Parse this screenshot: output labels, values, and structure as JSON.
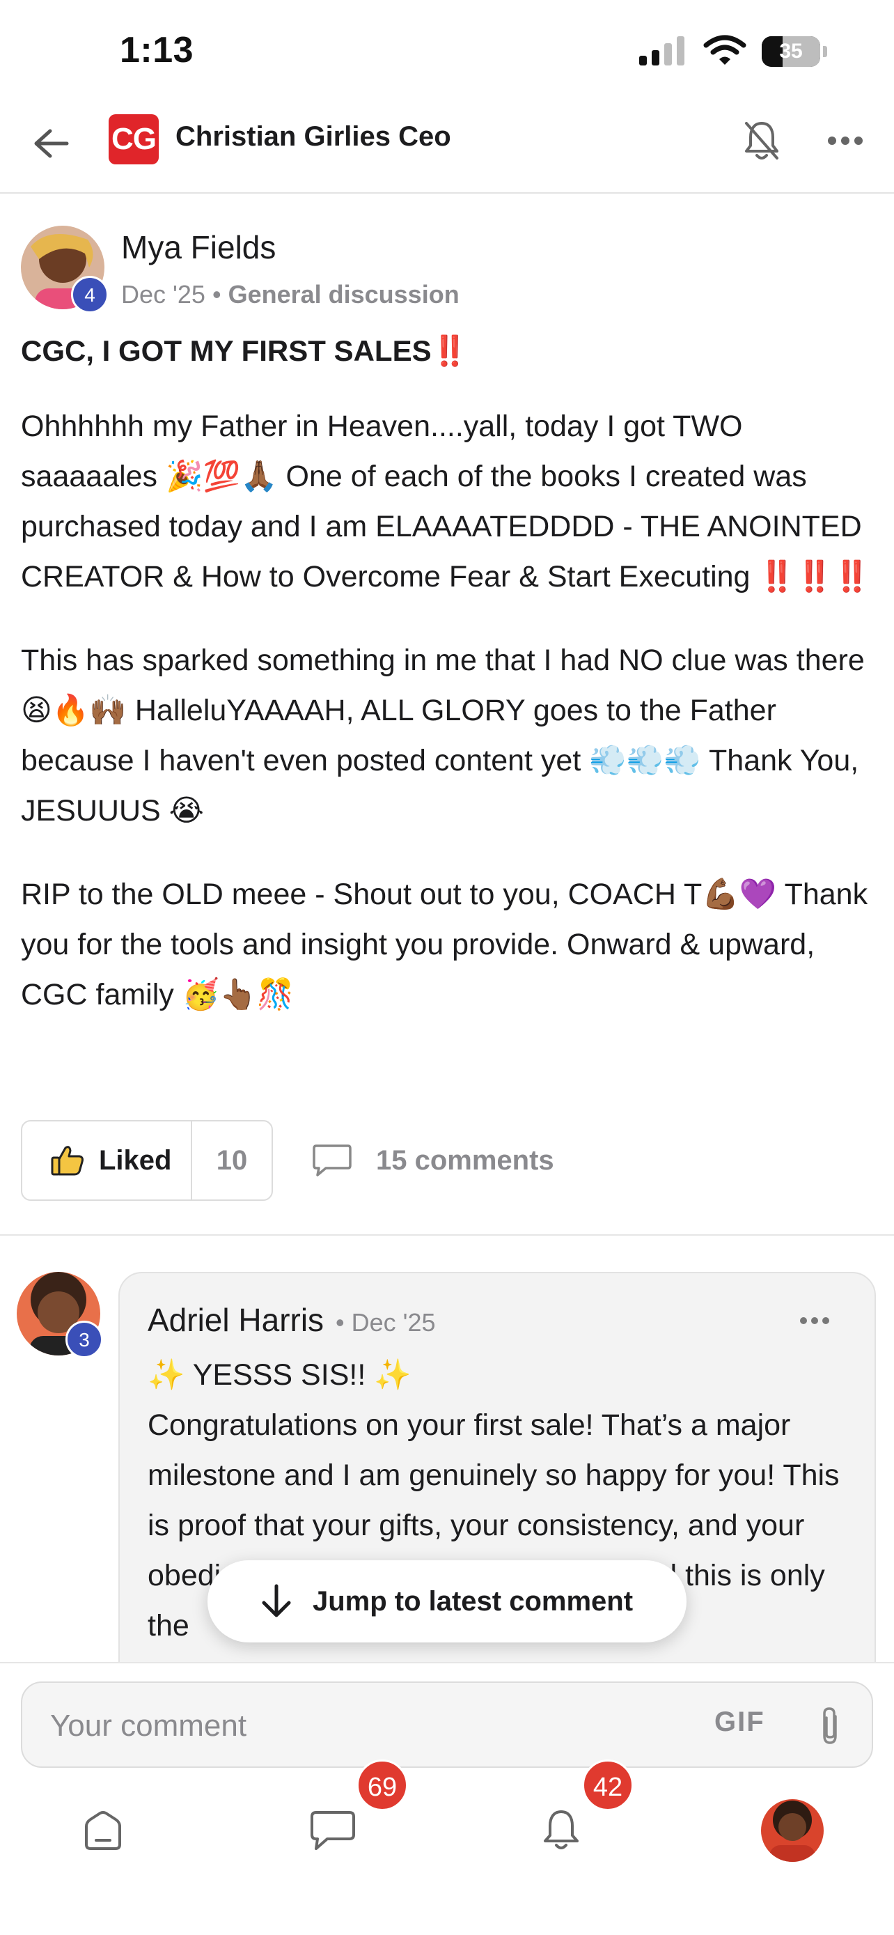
{
  "status_bar": {
    "time": "1:13",
    "battery": "35"
  },
  "header": {
    "group_logo_text": "CG",
    "group_name": "Christian Girlies Ceo"
  },
  "post": {
    "author": "Mya Fields",
    "author_level": "4",
    "date": "Dec '25",
    "category": "General discussion",
    "title": "CGC, I GOT MY FIRST SALES‼️",
    "paragraphs": [
      "Ohhhhhh my Father in Heaven....yall, today I got TWO saaaaales 🎉💯🙏🏾 One of each of the books I created was purchased today and I am ELAAAATEDDDD - THE ANOINTED CREATOR & How to Overcome Fear & Start Executing ‼️‼️‼️",
      "This has sparked something in me that I had NO clue was there 😫🔥🙌🏾 HalleluYAAAAH, ALL GLORY goes to the Father because I haven't even posted content yet 💨💨💨 Thank You, JESUUUS 😭",
      "RIP to the OLD meee - Shout out to you, COACH T💪🏾💜 Thank you for the tools and insight you provide. Onward & upward, CGC family 🥳👆🏾🎊"
    ],
    "like_label": "Liked",
    "like_count": "10",
    "comments_label": "15 comments"
  },
  "comment": {
    "author": "Adriel Harris",
    "author_level": "3",
    "date": "Dec '25",
    "body_line1": "✨ YESSS SIS!! ✨",
    "body_rest": "Congratulations on your first sale! That’s a major milestone and I am genuinely so happy for you! This is proof that your gifts, your consistency, and your obedience are making room for you and this is only the"
  },
  "jump_button": {
    "label": "Jump to latest comment"
  },
  "composer": {
    "placeholder": "Your comment",
    "gif_label": "GIF"
  },
  "tab_bar": {
    "messages_badge": "69",
    "notifications_badge": "42"
  },
  "colors": {
    "brand_red": "#e0252a",
    "level_badge_blue": "#3a4fb8",
    "notification_badge": "#e03a2f",
    "muted_text": "#8a8a8e"
  }
}
